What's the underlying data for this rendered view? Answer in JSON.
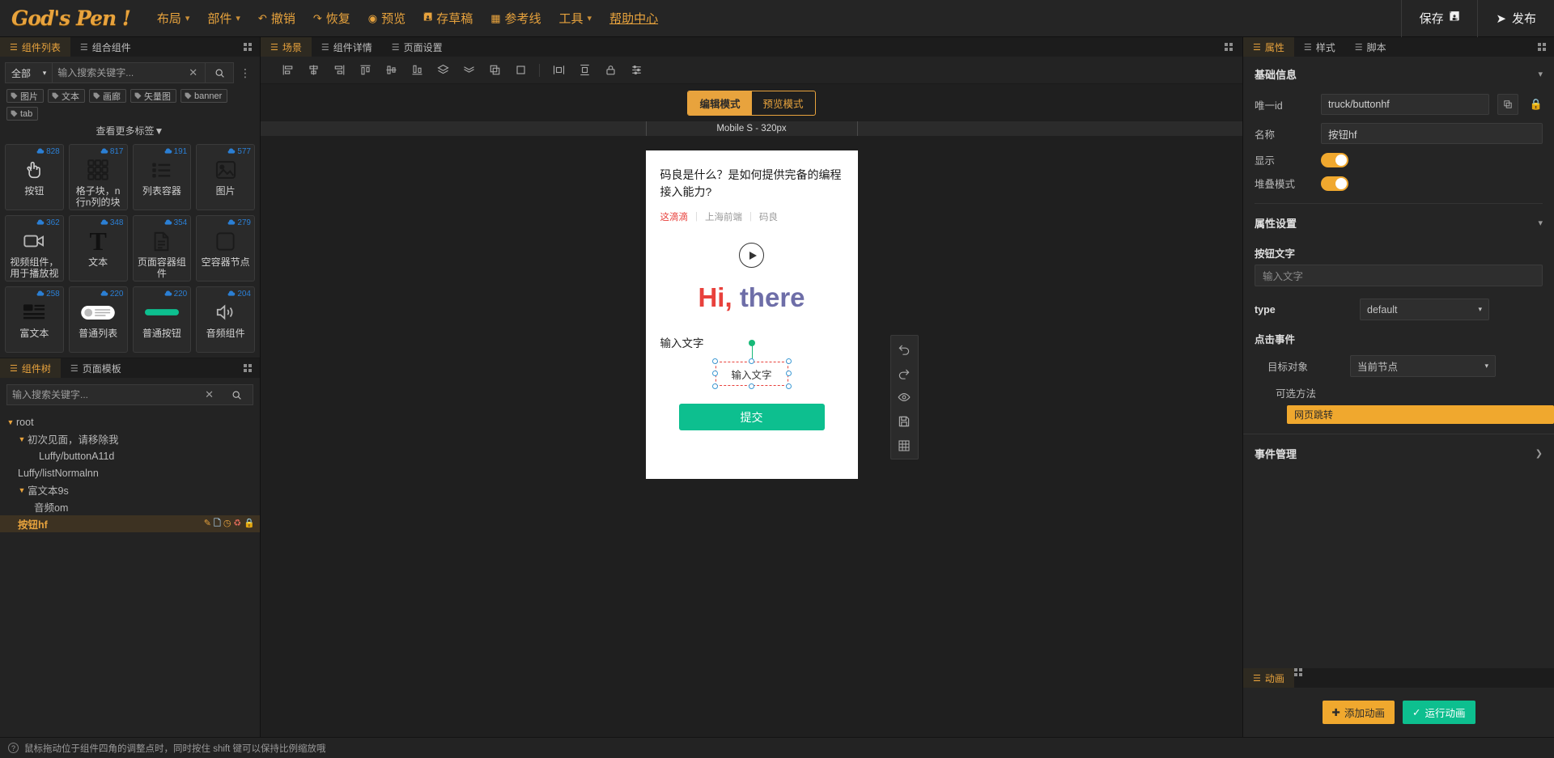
{
  "topbar": {
    "logo": "God's Pen !",
    "menu": [
      {
        "label": "布局",
        "icon": "chevron-down-icon",
        "caret": true
      },
      {
        "label": "部件",
        "icon": "chevron-down-icon",
        "caret": true
      },
      {
        "label": "撤销",
        "icon": "undo-icon",
        "caret": false
      },
      {
        "label": "恢复",
        "icon": "redo-icon",
        "caret": false
      },
      {
        "label": "预览",
        "icon": "eye-icon",
        "caret": false
      },
      {
        "label": "存草稿",
        "icon": "save-icon",
        "caret": false
      },
      {
        "label": "参考线",
        "icon": "grid-icon",
        "caret": false
      },
      {
        "label": "工具",
        "icon": "chevron-down-icon",
        "caret": true
      },
      {
        "label": "帮助中心",
        "icon": "help-icon",
        "caret": false
      }
    ],
    "save_label": "保存",
    "publish_label": "发布"
  },
  "left_panel": {
    "tabs": [
      {
        "label": "组件列表",
        "active": true
      },
      {
        "label": "组合组件",
        "active": false
      }
    ],
    "filter_select": "全部",
    "search_placeholder": "输入搜索关键字...",
    "search_value": "",
    "tags": [
      "图片",
      "文本",
      "画廊",
      "矢量图",
      "banner",
      "tab"
    ],
    "more_tags": "查看更多标签▼",
    "components": [
      {
        "label": "按钮",
        "downloads": "828",
        "icon": "hand-click-icon"
      },
      {
        "label": "格子块，n行n列的块",
        "downloads": "817",
        "icon": "grid-blocks-icon"
      },
      {
        "label": "列表容器",
        "downloads": "191",
        "icon": "list-icon"
      },
      {
        "label": "图片",
        "downloads": "577",
        "icon": "image-icon"
      },
      {
        "label": "视频组件，用于播放视",
        "downloads": "362",
        "icon": "video-icon"
      },
      {
        "label": "文本",
        "downloads": "348",
        "icon": "text-t-icon"
      },
      {
        "label": "页面容器组件",
        "downloads": "354",
        "icon": "document-icon"
      },
      {
        "label": "空容器节点",
        "downloads": "279",
        "icon": "square-icon"
      },
      {
        "label": "富文本",
        "downloads": "258",
        "icon": "rich-text-icon"
      },
      {
        "label": "普通列表",
        "downloads": "220",
        "icon": "plain-list-icon"
      },
      {
        "label": "普通按钮",
        "downloads": "220",
        "icon": "plain-button-icon"
      },
      {
        "label": "音频组件",
        "downloads": "204",
        "icon": "audio-icon"
      }
    ]
  },
  "tree_panel": {
    "tabs": [
      {
        "label": "组件树",
        "active": true
      },
      {
        "label": "页面模板",
        "active": false
      }
    ],
    "search_placeholder": "输入搜索关键字...",
    "search_value": "",
    "nodes": [
      {
        "label": "root",
        "indent": 0,
        "caret": true,
        "selected": false
      },
      {
        "label": "初次见面，请移除我",
        "indent": 1,
        "caret": true,
        "selected": false
      },
      {
        "label": "Luffy/buttonA11d",
        "indent": 2,
        "caret": false,
        "selected": false
      },
      {
        "label": "Luffy/listNormalnn",
        "indent": 1,
        "caret": false,
        "selected": false
      },
      {
        "label": "富文本9s",
        "indent": 1,
        "caret": true,
        "selected": false
      },
      {
        "label": "音频om",
        "indent": 2,
        "caret": false,
        "selected": false
      },
      {
        "label": "按钮hf",
        "indent": 2,
        "caret": false,
        "selected": true
      }
    ],
    "row_actions": [
      "edit-icon",
      "copy-icon",
      "clock-icon",
      "delete-icon",
      "lock-icon"
    ]
  },
  "center": {
    "tabs": [
      {
        "label": "场景",
        "active": true
      },
      {
        "label": "组件详情",
        "active": false
      },
      {
        "label": "页面设置",
        "active": false
      }
    ],
    "toolbar_icons": [
      "align-left-icon",
      "align-center-h-icon",
      "align-right-icon",
      "align-top-icon",
      "align-middle-icon",
      "align-bottom-icon",
      "layer-up-icon",
      "layer-down-icon",
      "copy-node-icon",
      "delete-node-icon",
      "distribute-h-icon",
      "distribute-v-icon",
      "lock-node-icon",
      "settings-node-icon"
    ],
    "modes": [
      {
        "label": "编辑模式",
        "active": true
      },
      {
        "label": "预览模式",
        "active": false
      }
    ],
    "device_label": "Mobile S - 320px",
    "float_tools": [
      "undo-icon",
      "redo-icon",
      "eye-icon",
      "save-icon",
      "grid-icon"
    ],
    "preview": {
      "article_title": "码良是什么？是如何提供完备的编程接入能力?",
      "source_tag": "这滴滴",
      "meta_1": "上海前端",
      "meta_2": "码良",
      "hi_part1": "Hi,",
      "hi_part2": "there",
      "input_label": "输入文字",
      "selected_input_text": "输入文字",
      "submit_label": "提交"
    }
  },
  "right_panel": {
    "tabs": [
      {
        "label": "属性",
        "active": true
      },
      {
        "label": "样式",
        "active": false
      },
      {
        "label": "脚本",
        "active": false
      }
    ],
    "basic_section_title": "基础信息",
    "fields": {
      "uid_label": "唯一id",
      "uid_value": "truck/buttonhf",
      "name_label": "名称",
      "name_value": "按钮hf",
      "show_label": "显示",
      "show_on": true,
      "stack_label": "堆叠模式",
      "stack_on": true
    },
    "props_section_title": "属性设置",
    "button_text_label": "按钮文字",
    "button_text_placeholder": "输入文字",
    "type_label": "type",
    "type_value": "default",
    "click_event_label": "点击事件",
    "target_label": "目标对象",
    "target_value": "当前节点",
    "optional_method_label": "可选方法",
    "method_chip": "网页跳转",
    "event_manage_label": "事件管理",
    "animation": {
      "tab_label": "动画",
      "add_label": "添加动画",
      "run_label": "运行动画"
    }
  },
  "statusbar": {
    "hint": "鼠标拖动位于组件四角的调整点时，同时按住 shift 键可以保持比例缩放哦"
  },
  "colors": {
    "accent": "#e8a33d",
    "brand_orange": "#f0a82e",
    "green": "#0dbf8f",
    "red": "#e8413c",
    "blue": "#2b7fd4"
  }
}
